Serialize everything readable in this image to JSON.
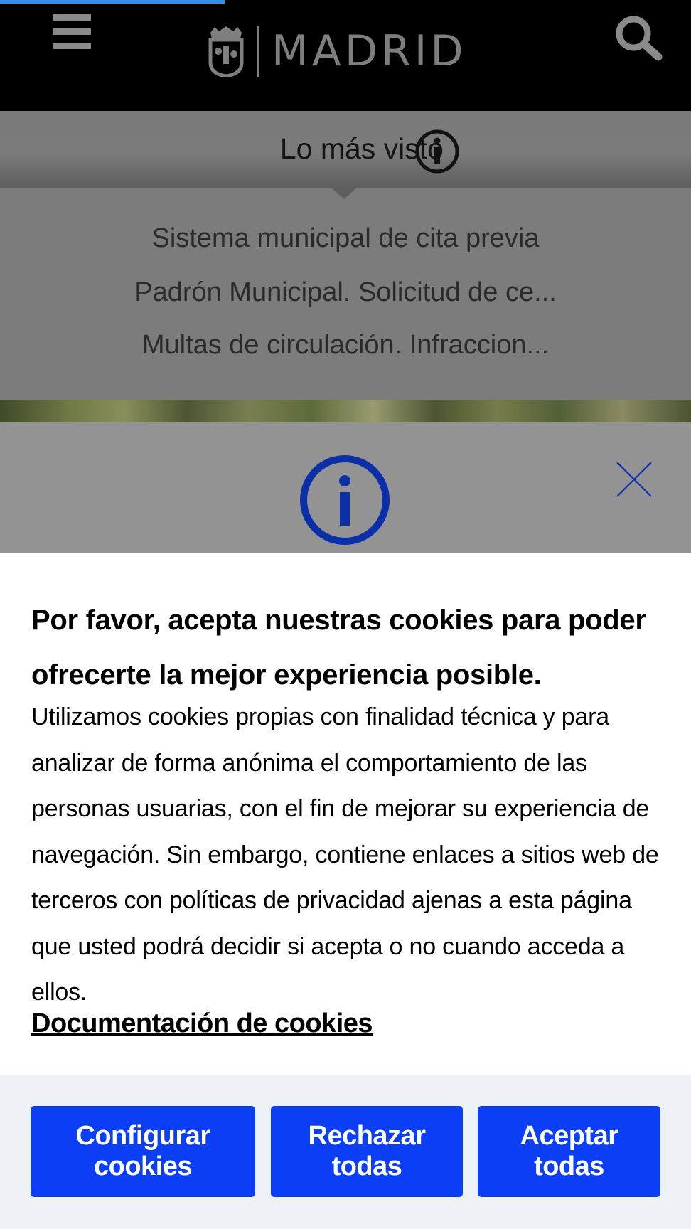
{
  "header": {
    "logo_title": "MADRID"
  },
  "most_viewed": {
    "title": "Lo más visto",
    "items": [
      "Sistema municipal de cita previa",
      "Padrón Municipal. Solicitud de ce...",
      "Multas de circulación. Infraccion..."
    ]
  },
  "cookie_banner": {
    "title": "Por favor, acepta nuestras cookies para poder ofrecerte la mejor experiencia posible.",
    "body": "Utilizamos cookies propias con finalidad técnica y para analizar de forma anónima el comportamiento de las personas usuarias, con el fin de mejorar su experiencia de navegación. Sin embargo, contiene enlaces a sitios web de terceros con políticas de privacidad ajenas a esta página que usted podrá decidir si acepta o no cuando acceda a ellos.",
    "doc_link": "Documentación de cookies",
    "buttons": {
      "configure_line1": "Configurar",
      "configure_line2": "cookies",
      "reject_line1": "Rechazar",
      "reject_line2": "todas",
      "accept_line1": "Aceptar",
      "accept_line2": "todas"
    }
  },
  "colors": {
    "header_bg": "#000000",
    "progress": "#2f8ff0",
    "accent_blue": "#0b3ef5",
    "modal_icon_blue": "#0a2fa8",
    "overlay_gray": "#939393"
  },
  "icons": {
    "menu": "hamburger-icon",
    "search": "search-icon",
    "info": "info-icon",
    "close": "close-icon",
    "crest": "madrid-crest-icon"
  }
}
